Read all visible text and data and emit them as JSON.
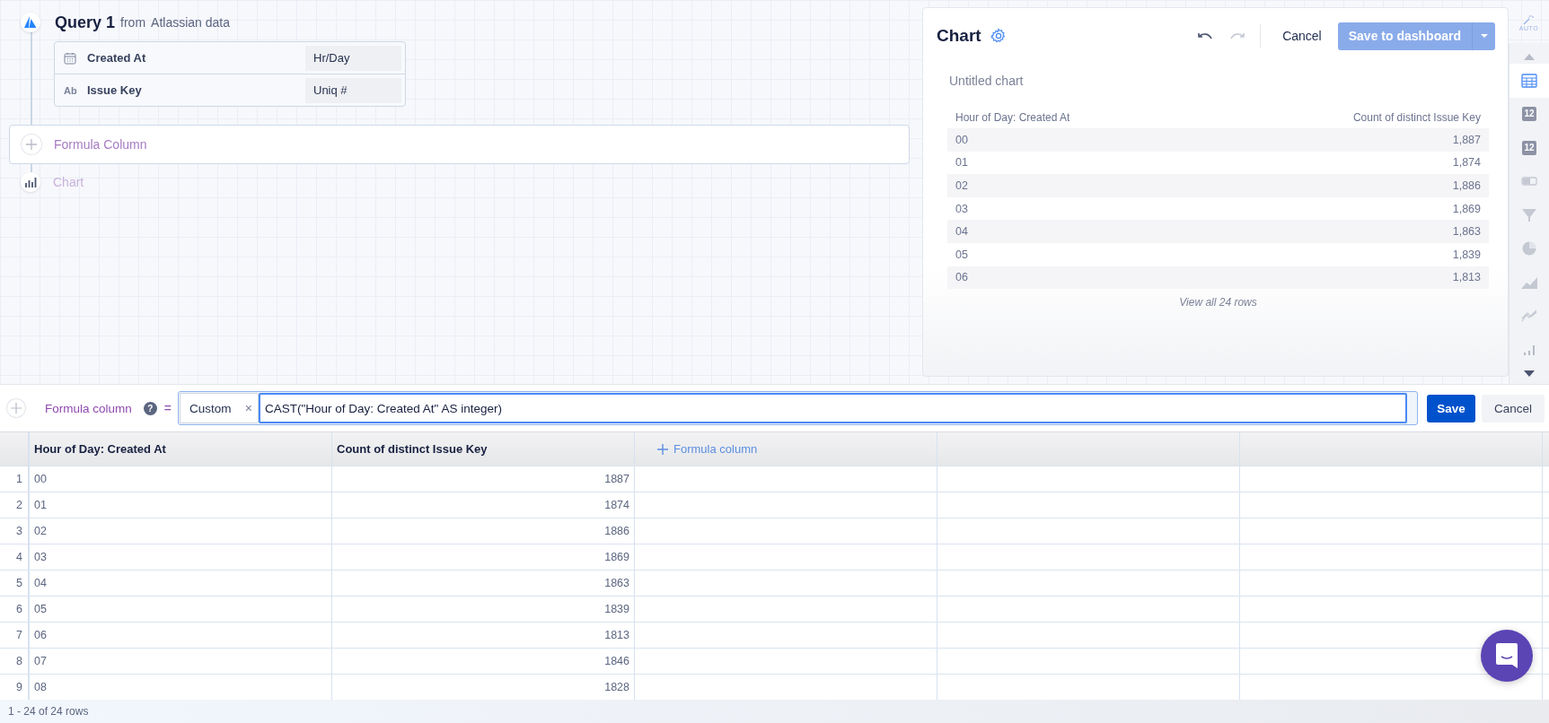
{
  "query": {
    "title": "Query 1",
    "source_prefix": "from",
    "source": "Atlassian data",
    "fields": [
      {
        "kind": "date",
        "name": "Created At",
        "aggregation": "Hr/Day"
      },
      {
        "kind": "text",
        "type_label": "Ab",
        "name": "Issue Key",
        "aggregation": "Uniq #"
      }
    ]
  },
  "pipeline": {
    "formula_step": "Formula Column",
    "chart_step": "Chart"
  },
  "chart_panel": {
    "title": "Chart",
    "cancel": "Cancel",
    "save": "Save to dashboard",
    "chart_title": "Untitled chart",
    "columns": [
      "Hour of Day: Created At",
      "Count of distinct Issue Key"
    ],
    "rows": [
      [
        "00",
        "1,887"
      ],
      [
        "01",
        "1,874"
      ],
      [
        "02",
        "1,886"
      ],
      [
        "03",
        "1,869"
      ],
      [
        "04",
        "1,863"
      ],
      [
        "05",
        "1,839"
      ],
      [
        "06",
        "1,813"
      ]
    ],
    "view_all": "View all 24 rows"
  },
  "rail": {
    "auto": "AUTO",
    "items": [
      {
        "kind": "table",
        "selected": true
      },
      {
        "kind": "number",
        "label": "12",
        "selected": false
      },
      {
        "kind": "trend",
        "label": "12",
        "selected": false
      },
      {
        "kind": "progress",
        "selected": false
      },
      {
        "kind": "funnel",
        "selected": false
      },
      {
        "kind": "pie",
        "selected": false
      },
      {
        "kind": "area",
        "selected": false
      },
      {
        "kind": "line",
        "selected": false
      },
      {
        "kind": "bar",
        "selected": false
      }
    ]
  },
  "formula_bar": {
    "label": "Formula column",
    "help": "?",
    "equals": "=",
    "type": "Custom",
    "clear": "×",
    "value": "CAST(\"Hour of Day: Created At\" AS integer)",
    "save": "Save",
    "cancel": "Cancel"
  },
  "grid": {
    "columns": [
      "Hour of Day: Created At",
      "Count of distinct Issue Key"
    ],
    "add_column": "Formula column",
    "rows": [
      {
        "number": "1",
        "cells": [
          "00",
          "1887"
        ]
      },
      {
        "number": "2",
        "cells": [
          "01",
          "1874"
        ]
      },
      {
        "number": "3",
        "cells": [
          "02",
          "1886"
        ]
      },
      {
        "number": "4",
        "cells": [
          "03",
          "1869"
        ]
      },
      {
        "number": "5",
        "cells": [
          "04",
          "1863"
        ]
      },
      {
        "number": "6",
        "cells": [
          "05",
          "1839"
        ]
      },
      {
        "number": "7",
        "cells": [
          "06",
          "1813"
        ]
      },
      {
        "number": "8",
        "cells": [
          "07",
          "1846"
        ]
      },
      {
        "number": "9",
        "cells": [
          "08",
          "1828"
        ]
      }
    ],
    "footer": "1 - 24 of 24 rows"
  }
}
